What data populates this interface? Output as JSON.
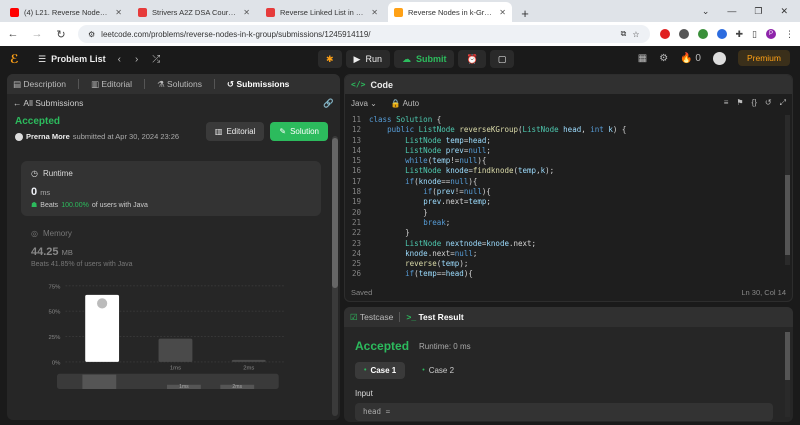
{
  "browser": {
    "tabs": [
      {
        "title": "(4) L21. Reverse Nodes in K Gro",
        "favicon_color": "#ff0000",
        "active": false
      },
      {
        "title": "Strivers A2Z DSA Course/Sheet",
        "favicon_color": "#e63b3b",
        "active": false
      },
      {
        "title": "Reverse Linked List in groups of",
        "favicon_color": "#e63b3b",
        "active": false
      },
      {
        "title": "Reverse Nodes in k-Group - Lee",
        "favicon_color": "#ffa116",
        "active": true
      }
    ],
    "url": "leetcode.com/problems/reverse-nodes-in-k-group/submissions/1245914119/",
    "profile_initial": "P"
  },
  "nav": {
    "problem_list": "Problem List",
    "run": "Run",
    "submit": "Submit",
    "fire_count": "0",
    "premium": "Premium"
  },
  "left": {
    "tabs": [
      "Description",
      "Editorial",
      "Solutions",
      "Submissions"
    ],
    "all_submissions": "All Submissions",
    "status": "Accepted",
    "submitter": "Prerna More",
    "submitted_at": "submitted at Apr 30, 2024 23:26",
    "editorial_btn": "Editorial",
    "solution_btn": "Solution",
    "runtime": {
      "label": "Runtime",
      "value": "0",
      "unit": "ms",
      "beats_label": "Beats",
      "beats_pct": "100.00%",
      "beats_suffix": "of users with Java"
    },
    "memory": {
      "label": "Memory",
      "value": "44.25",
      "unit": "MB",
      "beats_text": "Beats 41.85% of users with Java"
    }
  },
  "chart_data": {
    "type": "bar",
    "yticks": [
      "75%",
      "50%",
      "25%",
      "0%"
    ],
    "ylim": [
      0,
      75
    ],
    "categories": [
      "",
      "1ms",
      "2ms"
    ],
    "values": [
      66,
      23,
      2
    ],
    "highlight_index": 0,
    "highlight_color": "#ffffff",
    "bar_color": "#4a4a4a",
    "mini_categories": [
      "1ms",
      "2ms"
    ]
  },
  "code": {
    "title": "Code",
    "language": "Java",
    "mode": "Auto",
    "lines": [
      {
        "n": "11",
        "t": "class Solution {"
      },
      {
        "n": "12",
        "t": "    public ListNode reverseKGroup(ListNode head, int k) {"
      },
      {
        "n": "13",
        "t": "        ListNode temp=head;"
      },
      {
        "n": "14",
        "t": "        ListNode prev=null;"
      },
      {
        "n": "15",
        "t": "        while(temp!=null){"
      },
      {
        "n": "16",
        "t": "        ListNode knode=findknode(temp,k);"
      },
      {
        "n": "17",
        "t": "        if(knode==null){"
      },
      {
        "n": "18",
        "t": "            if(prev!=null){"
      },
      {
        "n": "19",
        "t": "            prev.next=temp;"
      },
      {
        "n": "20",
        "t": "            }"
      },
      {
        "n": "21",
        "t": "            break;"
      },
      {
        "n": "22",
        "t": "        }"
      },
      {
        "n": "23",
        "t": "        ListNode nextnode=knode.next;"
      },
      {
        "n": "24",
        "t": "        knode.next=null;"
      },
      {
        "n": "25",
        "t": "        reverse(temp);"
      },
      {
        "n": "26",
        "t": "        if(temp==head){"
      }
    ],
    "saved": "Saved",
    "position": "Ln 30, Col 14"
  },
  "test": {
    "testcase_tab": "Testcase",
    "result_tab": "Test Result",
    "status": "Accepted",
    "runtime": "Runtime: 0 ms",
    "cases": [
      "Case 1",
      "Case 2"
    ],
    "input_label": "Input",
    "input_value": "head ="
  }
}
